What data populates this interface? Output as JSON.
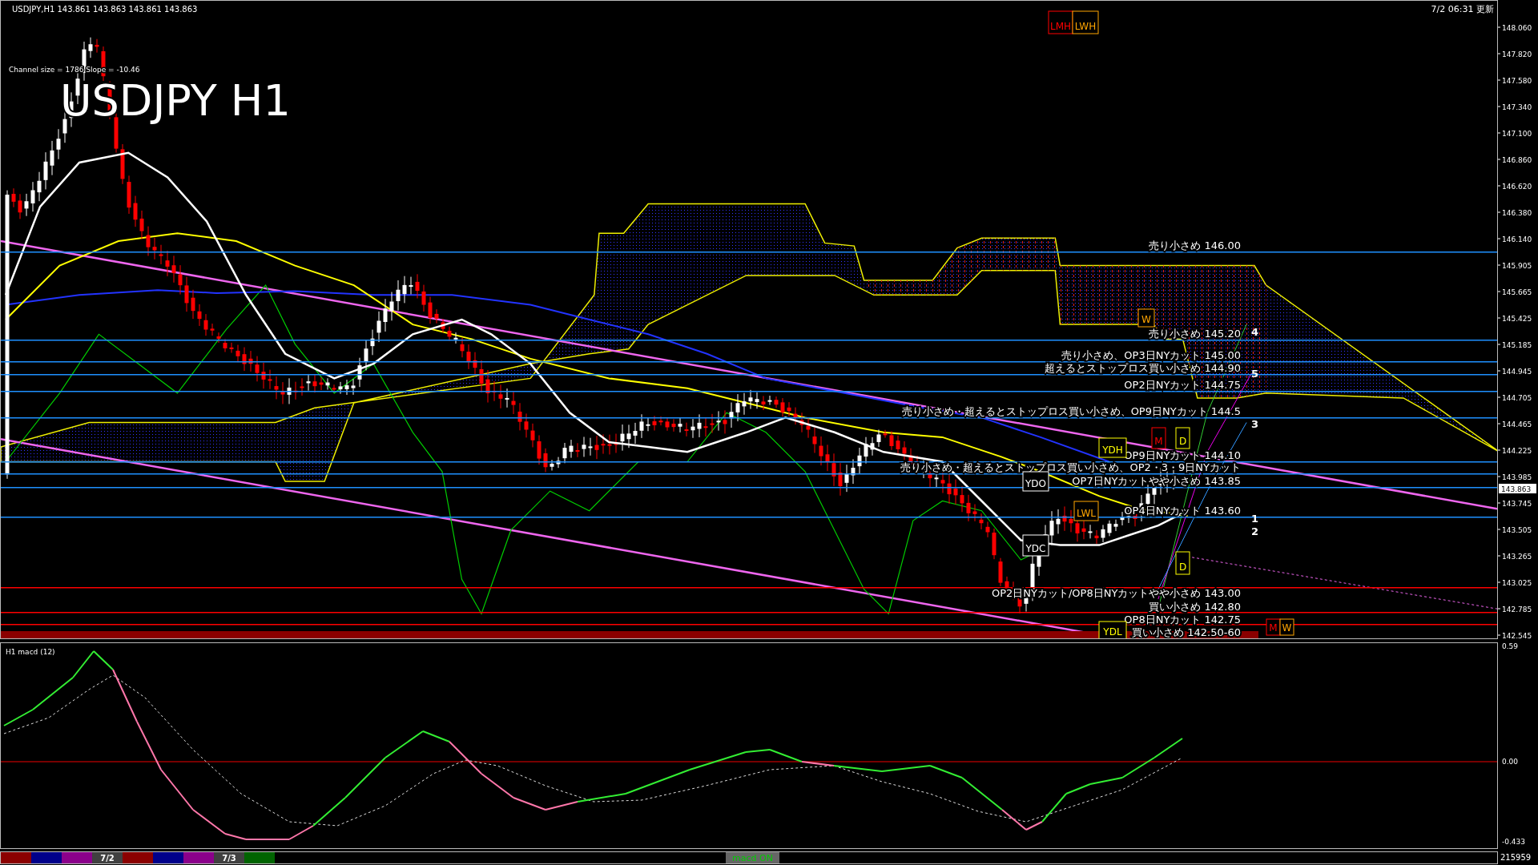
{
  "header": {
    "symbol_info": "USDJPY,H1  143.861 143.863 143.861 143.863",
    "channel_info": "Channel size = 1786 Slope = -10.46",
    "title": "USDJPY H1",
    "updated": "7/2 06:31 更新"
  },
  "price_axis": {
    "ticks": [
      "148.060",
      "147.820",
      "147.580",
      "147.340",
      "147.100",
      "146.860",
      "146.620",
      "146.380",
      "146.140",
      "145.905",
      "145.665",
      "145.425",
      "145.185",
      "144.945",
      "144.705",
      "144.465",
      "144.225",
      "143.985",
      "143.745",
      "143.505",
      "143.265",
      "143.025",
      "142.785",
      "142.545"
    ],
    "current_price": "143.863"
  },
  "levels": [
    {
      "kind": "line",
      "label": "売り小さめ 146.00",
      "color": "#1e90ff"
    },
    {
      "kind": "line",
      "label": "売り小さめ 145.20",
      "color": "#1e90ff"
    },
    {
      "kind": "line",
      "label": "売り小さめ、OP3日NYカット 145.00",
      "color": "#1e90ff"
    },
    {
      "kind": "line",
      "label": "超えるとストップロス買い小さめ 144.90",
      "color": "#1e90ff"
    },
    {
      "kind": "line",
      "label": "OP2日NYカット 144.75",
      "color": "#1e90ff"
    },
    {
      "kind": "line",
      "label": "売り小さめ・超えるとストップロス買い小さめ、OP9日NYカット 144.5",
      "color": "#1e90ff"
    },
    {
      "kind": "line",
      "label": "OP9日NYカット 144.10",
      "color": "#1e90ff"
    },
    {
      "kind": "line",
      "label": "売り小さめ・超えるとストップロス買い小さめ、OP2・3・9日NYカット",
      "color": "#1e90ff"
    },
    {
      "kind": "line",
      "label": "OP7日NYカットやや小さめ 143.85",
      "color": "#1e90ff"
    },
    {
      "kind": "line",
      "label": "OP4日NYカット 143.60",
      "color": "#1e90ff"
    },
    {
      "kind": "line",
      "label": "OP2日NYカット/OP8日NYカットやや小さめ 143.00",
      "color": "#ff0000"
    },
    {
      "kind": "line",
      "label": "買い小さめ 142.80",
      "color": "#ff0000"
    },
    {
      "kind": "line",
      "label": "OP8日NYカット 142.75",
      "color": "#ff0000"
    },
    {
      "kind": "band",
      "label": "買い小さめ 142.50-60",
      "color": "#8b0000"
    }
  ],
  "wave_numbers": [
    "4",
    "5",
    "3",
    "1",
    "2"
  ],
  "markers": [
    {
      "label": "LMH",
      "color": "#ff0000"
    },
    {
      "label": "LWH",
      "color": "#ffa500"
    },
    {
      "label": "YDO",
      "color": "#ffffff"
    },
    {
      "label": "YDH",
      "color": "#ffff00"
    },
    {
      "label": "YDC",
      "color": "#ffffff"
    },
    {
      "label": "LWL",
      "color": "#ffa500"
    },
    {
      "label": "YDL",
      "color": "#ffff00"
    },
    {
      "label": "M",
      "color": "#ff0000"
    },
    {
      "label": "D",
      "color": "#ffff00"
    },
    {
      "label": "W",
      "color": "#ffa500"
    },
    {
      "label": "D",
      "color": "#ffff00"
    },
    {
      "label": "M",
      "color": "#ff0000"
    },
    {
      "label": "W",
      "color": "#ffa500"
    }
  ],
  "macd": {
    "title": "H1  macd (12)",
    "ticks": [
      "0.59",
      "0.00",
      "-0.433"
    ]
  },
  "timeline": [
    {
      "color": "#8b0000"
    },
    {
      "color": "#00008b"
    },
    {
      "color": "#8b008b"
    },
    {
      "color": "#404040",
      "label": "7/2"
    },
    {
      "color": "#8b0000"
    },
    {
      "color": "#00008b"
    },
    {
      "color": "#8b008b"
    },
    {
      "color": "#404040",
      "label": "7/3"
    },
    {
      "color": "#006400"
    }
  ],
  "macd_button": "macd ON",
  "bar_count": "215959"
}
